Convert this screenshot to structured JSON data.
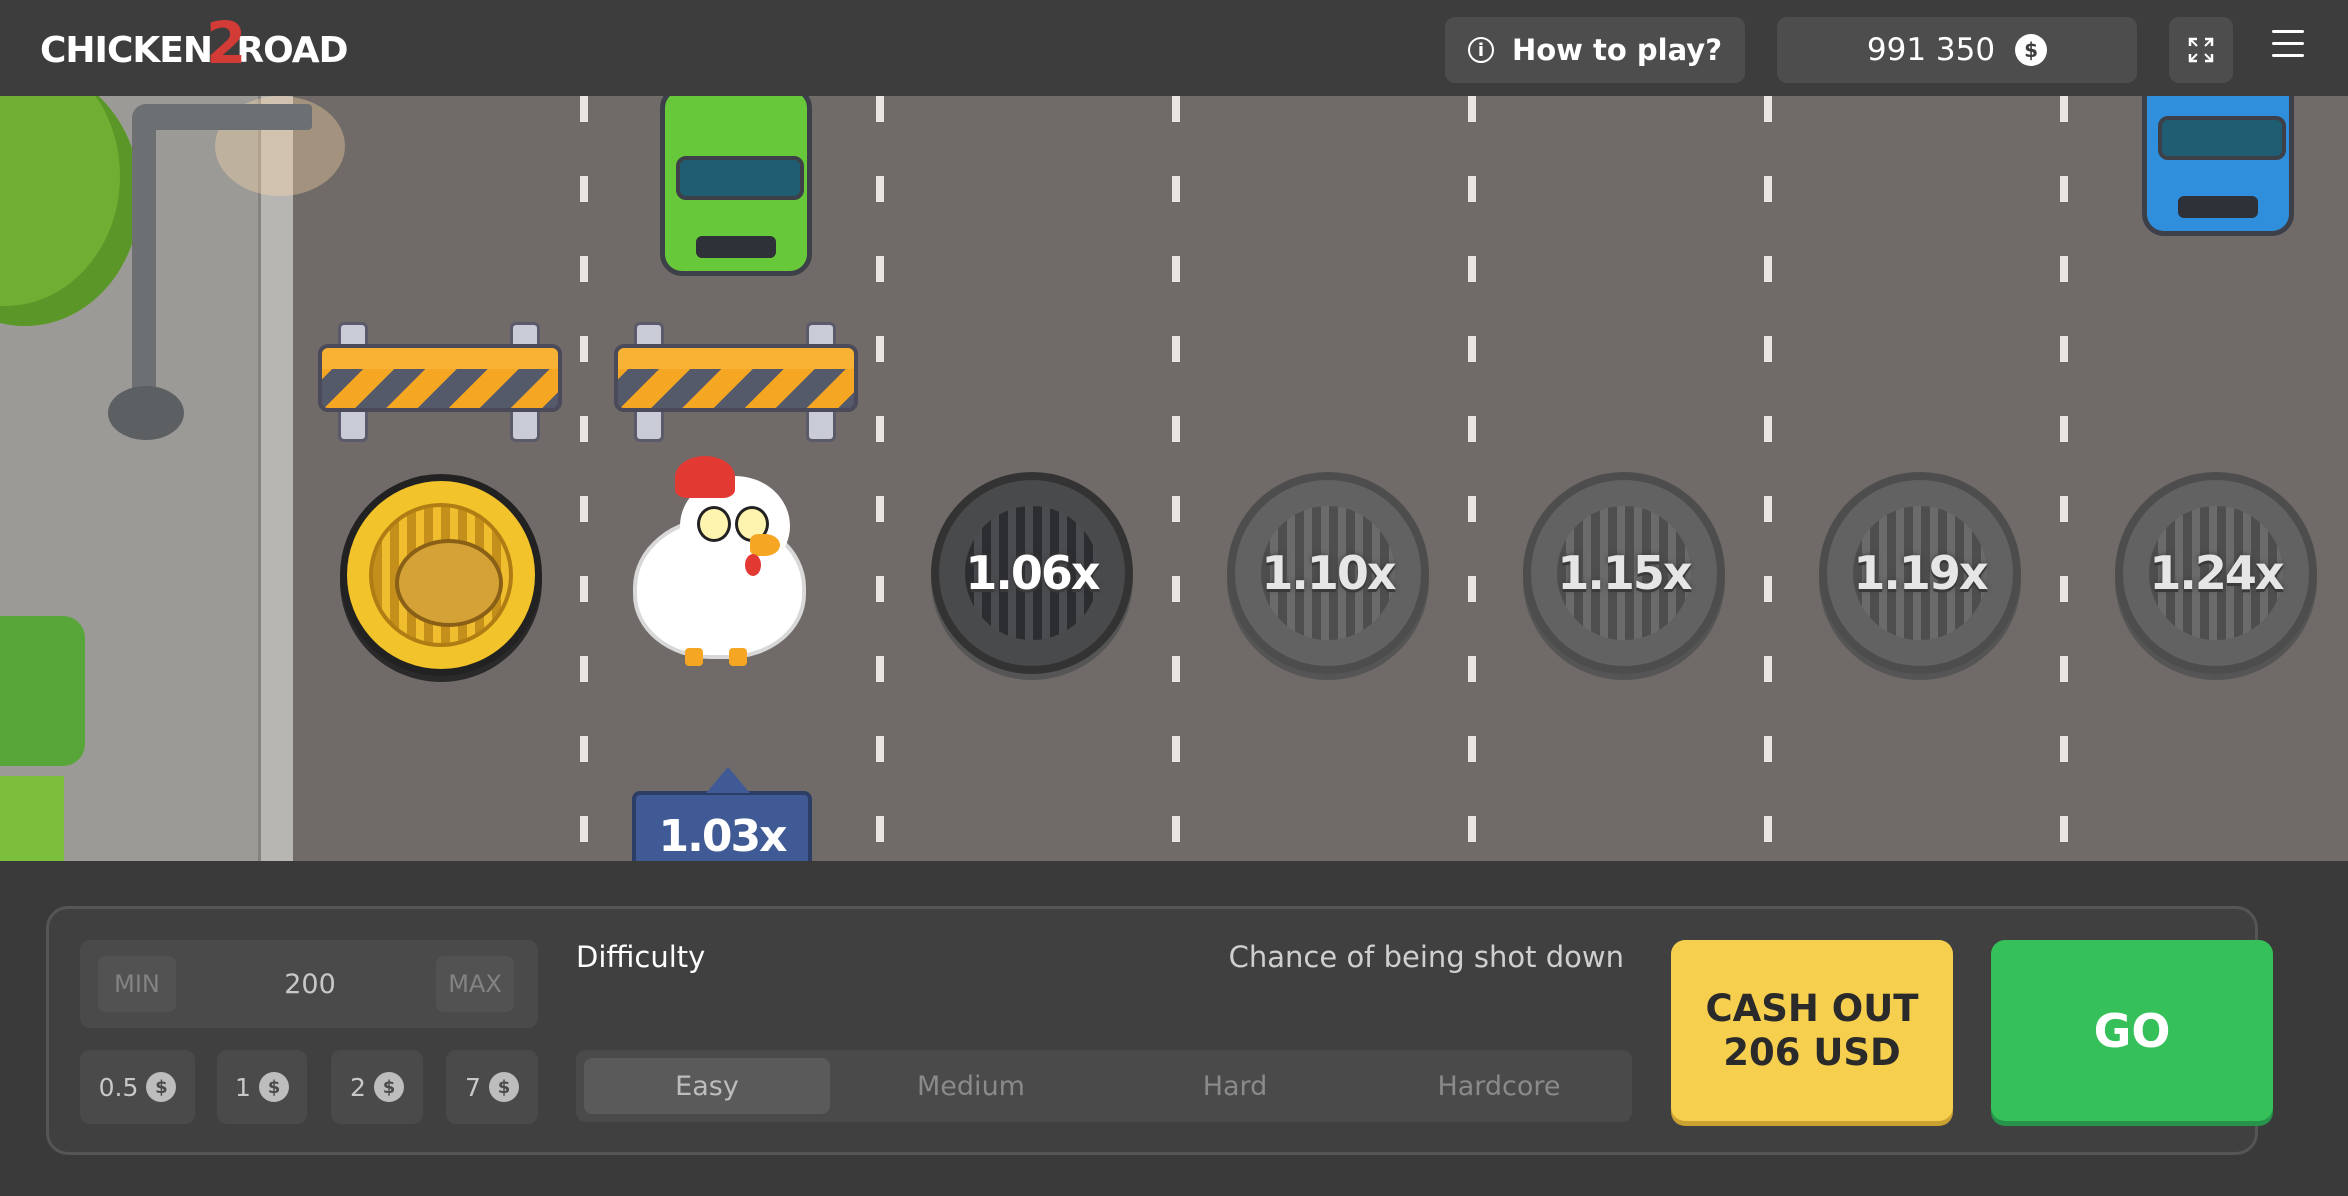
{
  "header": {
    "logo_word1": "CHICKEN",
    "logo_digit": "2",
    "logo_word2": "ROAD",
    "how_to_play": "How to play?",
    "balance": "991 350",
    "currency_symbol": "$"
  },
  "game": {
    "current_multiplier": "1.03x",
    "multipliers": [
      "1.06x",
      "1.10x",
      "1.15x",
      "1.19x",
      "1.24x"
    ]
  },
  "controls": {
    "bet_min": "MIN",
    "bet_value": "200",
    "bet_max": "MAX",
    "chips": [
      {
        "value": "0.5",
        "symbol": "$"
      },
      {
        "value": "1",
        "symbol": "$"
      },
      {
        "value": "2",
        "symbol": "$"
      },
      {
        "value": "7",
        "symbol": "$"
      }
    ],
    "difficulty_label": "Difficulty",
    "chance_label": "Chance of being shot down",
    "difficulty_options": [
      "Easy",
      "Medium",
      "Hard",
      "Hardcore"
    ],
    "selected_difficulty": "Easy",
    "cash_out_line1": "CASH OUT",
    "cash_out_line2": "206 USD",
    "go_label": "GO"
  },
  "colors": {
    "road": "#706b68",
    "cash_out": "#f7cf4f",
    "go": "#35c05a",
    "tooltip": "#3f5a94"
  }
}
